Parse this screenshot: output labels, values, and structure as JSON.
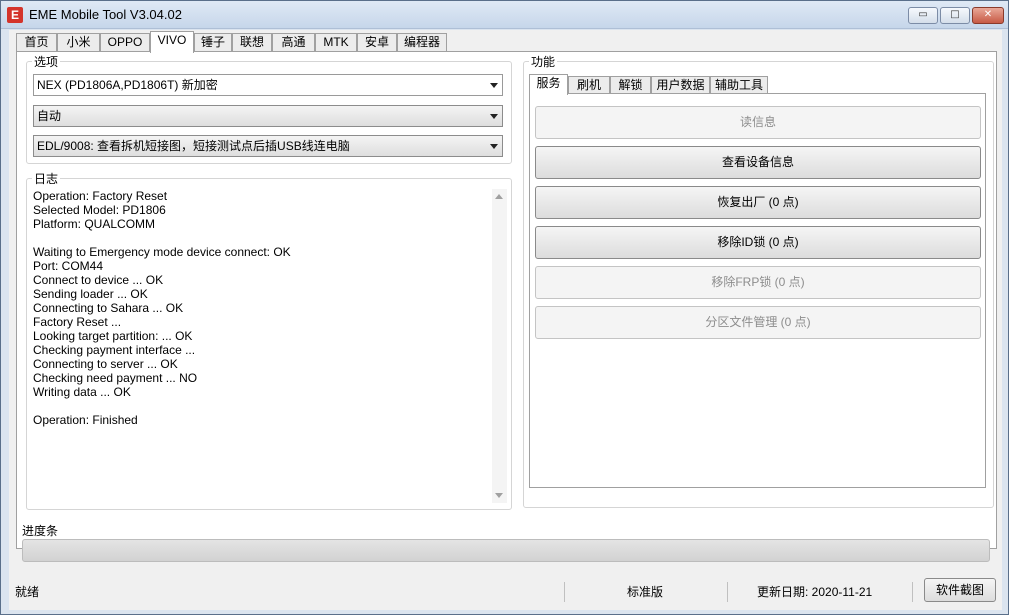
{
  "window": {
    "title": "EME Mobile Tool V3.04.02",
    "icon_letter": "E",
    "min_glyph": "▭",
    "max_glyph": "□",
    "close_glyph": "✕"
  },
  "top_tabs": [
    {
      "label": "首页",
      "active": false
    },
    {
      "label": "小米",
      "active": false
    },
    {
      "label": "OPPO",
      "active": false
    },
    {
      "label": "VIVO",
      "active": true
    },
    {
      "label": "锤子",
      "active": false
    },
    {
      "label": "联想",
      "active": false
    },
    {
      "label": "高通",
      "active": false
    },
    {
      "label": "MTK",
      "active": false
    },
    {
      "label": "安卓",
      "active": false
    },
    {
      "label": "编程器",
      "active": false
    }
  ],
  "options": {
    "label": "选项",
    "model_select": "NEX (PD1806A,PD1806T) 新加密",
    "mode_select": "自动",
    "method_select": "EDL/9008: 查看拆机短接图，短接测试点后插USB线连电脑"
  },
  "log": {
    "label": "日志",
    "lines": [
      "Operation: Factory Reset",
      "Selected Model: PD1806",
      "Platform: QUALCOMM",
      "",
      "Waiting to Emergency mode device connect: OK",
      "Port: COM44",
      "Connect to device ... OK",
      "Sending loader ... OK",
      "Connecting to Sahara ... OK",
      "Factory Reset ...",
      "Looking target partition: ... OK",
      "Checking payment interface ...",
      "Connecting to server ... OK",
      "Checking need payment ... NO",
      "Writing data ... OK",
      "",
      "Operation: Finished"
    ]
  },
  "functions": {
    "label": "功能",
    "tabs": [
      {
        "label": "服务",
        "active": true
      },
      {
        "label": "刷机",
        "active": false
      },
      {
        "label": "解锁",
        "active": false
      },
      {
        "label": "用户数据",
        "active": false
      },
      {
        "label": "辅助工具",
        "active": false
      }
    ],
    "buttons": [
      {
        "label": "读信息",
        "enabled": false
      },
      {
        "label": "查看设备信息",
        "enabled": true
      },
      {
        "label": "恢复出厂 (0 点)",
        "enabled": true
      },
      {
        "label": "移除ID锁 (0 点)",
        "enabled": true
      },
      {
        "label": "移除FRP锁 (0 点)",
        "enabled": false
      },
      {
        "label": "分区文件管理 (0 点)",
        "enabled": false
      }
    ]
  },
  "progress": {
    "label": "进度条",
    "fraction": 0
  },
  "status": {
    "state": "就绪",
    "edition": "标准版",
    "update_date": "更新日期: 2020-11-21",
    "screenshot_button": "软件截图"
  },
  "colors": {
    "close_button": "#c75a45",
    "app_icon": "#d4342b",
    "progress_fill": "#2fb33a"
  }
}
